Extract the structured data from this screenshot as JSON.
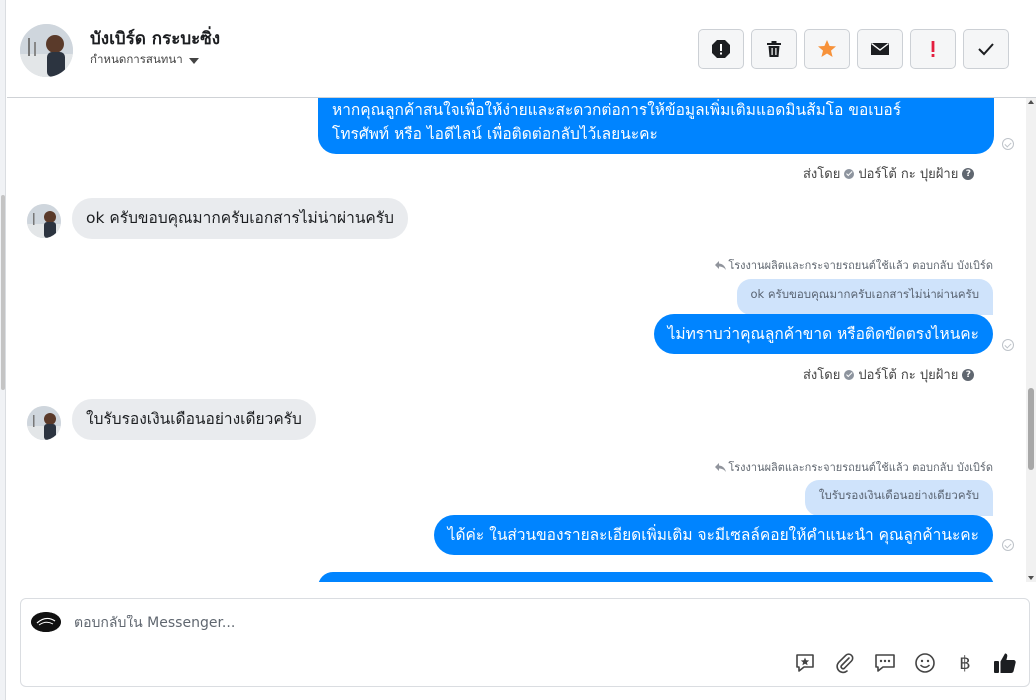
{
  "header": {
    "contact_name": "บังเบิร์ด กระบะซิ่ง",
    "conversation_settings": "กำหนดการสนทนา",
    "actions": [
      {
        "name": "report-icon"
      },
      {
        "name": "trash-icon"
      },
      {
        "name": "star-icon",
        "color": "#f7923a"
      },
      {
        "name": "envelope-icon"
      },
      {
        "name": "exclamation-icon",
        "color": "#e41e3f"
      },
      {
        "name": "check-icon"
      }
    ]
  },
  "messages": {
    "out_1_line1": "หากคุณลูกค้าสนใจเพื่อให้ง่ายและสะดวกต่อการให้ข้อมูลเพิ่มเติมแอดมินส้มโอ ขอเบอร์",
    "out_1_line2": "โทรศัพท์ หรือ ไอดีไลน์ เพื่อติดต่อกลับไว้เลยนะคะ",
    "sent_by_label": "ส่งโดย",
    "sender_name": "ปอร์โต้ กะ ปุยฝ้าย",
    "in_1": "ok ครับขอบคุณมากครับเอกสารไม่น่าผ่านครับ",
    "reply_note": "โรงงานผลิตและกระจายรถยนต์ใช้แล้ว ตอบกลับ บังเบิร์ด",
    "quote_1": "ok ครับขอบคุณมากครับเอกสารไม่น่าผ่านครับ",
    "out_2": "ไม่ทราบว่าคุณลูกค้าขาด หรือติดขัดตรงไหนคะ",
    "in_2": "ใบรับรองเงินเดือนอย่างเดียวครับ",
    "quote_2": "ใบรับรองเงินเดือนอย่างเดียวครับ",
    "out_3": "ได้ค่ะ ในส่วนของรายละเอียดเพิ่มเติม จะมีเซลล์คอยให้คำแนะนำ คุณลูกค้านะคะ"
  },
  "composer": {
    "placeholder": "ตอบกลับใน Messenger...",
    "tools": [
      "sticker-icon",
      "attach-icon",
      "quick-reply-icon",
      "emoji-icon",
      "baht-icon",
      "thumbs-up-icon"
    ],
    "baht_symbol": "฿"
  },
  "colors": {
    "outgoing_bubble": "#0084ff",
    "incoming_bubble": "#e9ebee",
    "quote_bubble": "#cfe3fb"
  }
}
